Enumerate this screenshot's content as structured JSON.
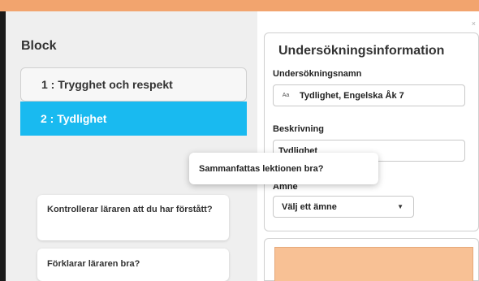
{
  "block_panel": {
    "title": "Block",
    "items": [
      {
        "label": "1 : Trygghet och respekt"
      },
      {
        "label": "2 : Tydlighet"
      }
    ]
  },
  "questions": [
    {
      "text": "Kontrollerar läraren att du har förstått?"
    },
    {
      "text": "Förklarar läraren bra?"
    }
  ],
  "dragging_question": {
    "text": "Sammanfattas lektionen bra?"
  },
  "survey_info": {
    "title": "Undersökningsinformation",
    "name_label": "Undersökningsnamn",
    "name_icon_text": "Aa",
    "name_value": "Tydlighet, Engelska Åk 7",
    "description_label": "Beskrivning",
    "description_value": "Tydlighet",
    "subject_label": "Ämne",
    "subject_value": "Välj ett ämne"
  },
  "icons": {
    "close": "close-icon",
    "text_type": "text-type-icon",
    "dropdown": "caret-down-icon"
  },
  "colors": {
    "header_bar": "#f2a46e",
    "active_block": "#19baf0",
    "drop_zone": "#f8c195"
  }
}
